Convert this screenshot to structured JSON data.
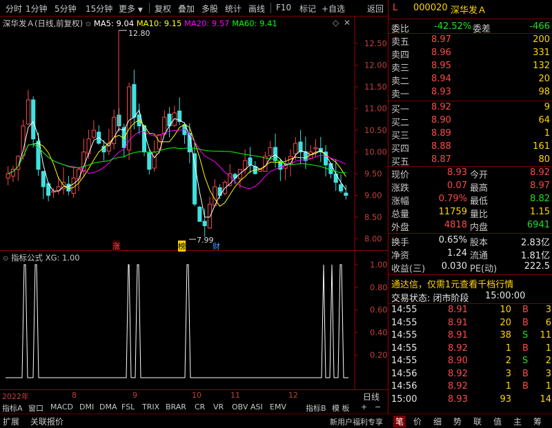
{
  "toolbar": {
    "items": [
      "分时",
      "1分钟",
      "5分钟",
      "15分钟",
      "更多",
      "复权",
      "叠加",
      "多股",
      "统计",
      "画线",
      "F10",
      "标记",
      "+自选",
      "返回"
    ]
  },
  "chart_header": {
    "title": "深华发Ａ(日线,前复权)",
    "ma5": "MA5: 9.04",
    "ma10": "MA10: 9.15",
    "ma20": "MA20: 9.57",
    "ma60": "MA60: 9.41"
  },
  "price_axis": [
    "12.50",
    "12.00",
    "11.50",
    "11.00",
    "10.50",
    "10.00",
    "9.50",
    "9.00",
    "8.50",
    "8.00"
  ],
  "annotations": {
    "high": "12.80",
    "low": "7.99"
  },
  "markers": [
    "涨",
    "榜",
    "财"
  ],
  "indicator_header": "指标公式 XG: 1.00",
  "indicator_axis": [
    "1.00",
    "0.80",
    "0.60",
    "0.40",
    "0.20"
  ],
  "date_axis": [
    "2022年",
    "8",
    "9",
    "10",
    "11",
    "12"
  ],
  "axis_label_right": "日线",
  "indicator_tabs": [
    "指标A",
    "窗口",
    "MACD",
    "DMI",
    "DMA",
    "FSL",
    "TRIX",
    "BRAR",
    "CR",
    "VR",
    "OBV",
    "ASI",
    "EMV",
    "指标B",
    "模 板",
    "+",
    "−"
  ],
  "bottom_left": [
    "扩展",
    "关联报价"
  ],
  "bottom_right": "新用户福利专享",
  "bottom_nav": [
    "笔",
    "价",
    "细",
    "势",
    "联",
    "值",
    "主",
    "筹"
  ],
  "quote": {
    "prefix": "L",
    "code": "000020",
    "name": "深华发Ａ",
    "webi_label": "委比",
    "webi": "-42.52%",
    "weicha_label": "委差",
    "weicha": "-466",
    "asks": [
      {
        "label": "卖五",
        "price": "8.97",
        "vol": "200"
      },
      {
        "label": "卖四",
        "price": "8.96",
        "vol": "331"
      },
      {
        "label": "卖三",
        "price": "8.95",
        "vol": "132"
      },
      {
        "label": "卖二",
        "price": "8.94",
        "vol": "20"
      },
      {
        "label": "卖一",
        "price": "8.93",
        "vol": "98"
      }
    ],
    "bids": [
      {
        "label": "买一",
        "price": "8.92",
        "vol": "9"
      },
      {
        "label": "买二",
        "price": "8.90",
        "vol": "64"
      },
      {
        "label": "买三",
        "price": "8.89",
        "vol": "1"
      },
      {
        "label": "买四",
        "price": "8.88",
        "vol": "161"
      },
      {
        "label": "买五",
        "price": "8.87",
        "vol": "80"
      }
    ],
    "stats": [
      {
        "l1": "现价",
        "v1": "8.93",
        "l2": "今开",
        "v2": "8.92"
      },
      {
        "l1": "涨跌",
        "v1": "0.07",
        "l2": "最高",
        "v2": "8.97"
      },
      {
        "l1": "涨幅",
        "v1": "0.79%",
        "l2": "最低",
        "v2": "8.82"
      },
      {
        "l1": "总量",
        "v1": "11759",
        "l2": "量比",
        "v2": "1.15"
      },
      {
        "l1": "外盘",
        "v1": "4818",
        "l2": "内盘",
        "v2": "6941"
      }
    ],
    "stats2": [
      {
        "l1": "换手",
        "v1": "0.65%",
        "l2": "股本",
        "v2": "2.83亿"
      },
      {
        "l1": "净资",
        "v1": "1.24",
        "l2": "流通",
        "v2": "1.81亿"
      },
      {
        "l1": "收益(三)",
        "v1": "0.030",
        "l2": "PE(动)",
        "v2": "222.5"
      }
    ],
    "promo": "通达信，仅需1元查看千档行情",
    "status_label": "交易状态: 闭市阶段",
    "status_time": "15:00:00",
    "ticks": [
      {
        "time": "14:55",
        "price": "8.91",
        "vol": "10",
        "bs": "B",
        "n": "3"
      },
      {
        "time": "14:55",
        "price": "8.91",
        "vol": "20",
        "bs": "B",
        "n": "6"
      },
      {
        "time": "14:55",
        "price": "8.91",
        "vol": "38",
        "bs": "S",
        "n": "11"
      },
      {
        "time": "14:55",
        "price": "8.92",
        "vol": "1",
        "bs": "B",
        "n": "1"
      },
      {
        "time": "14:55",
        "price": "8.90",
        "vol": "2",
        "bs": "S",
        "n": "2"
      },
      {
        "time": "14:56",
        "price": "8.92",
        "vol": "3",
        "bs": "B",
        "n": "3"
      },
      {
        "time": "14:56",
        "price": "8.92",
        "vol": "1",
        "bs": "B",
        "n": "1"
      },
      {
        "time": "15:00",
        "price": "8.93",
        "vol": "93",
        "bs": "",
        "n": "14"
      }
    ]
  },
  "colors": {
    "up": "#ff4a4a",
    "down": "#22e022",
    "ma5": "#ffffff",
    "ma10": "#ffff00",
    "ma20": "#ff00ff",
    "ma60": "#00ff00",
    "border": "#9a0000"
  }
}
